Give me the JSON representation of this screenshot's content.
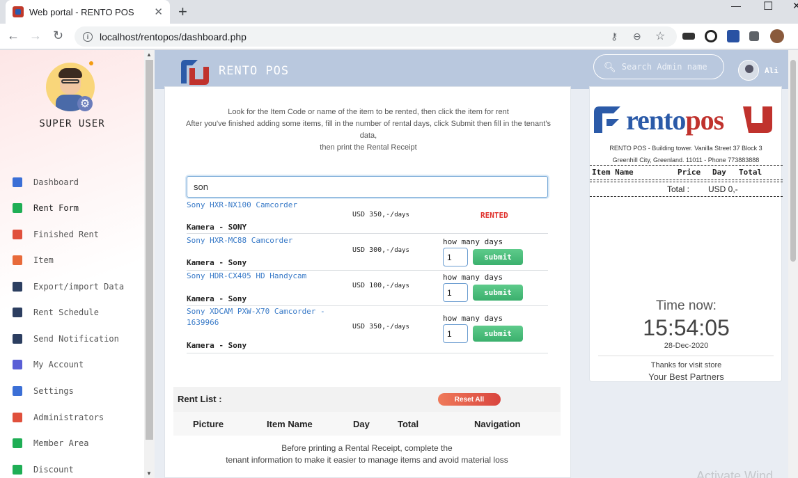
{
  "browser": {
    "tab_title": "Web portal - RENTO POS",
    "url": "localhost/rentopos/dashboard.php"
  },
  "sidebar": {
    "role": "SUPER USER",
    "items": [
      {
        "label": "Dashboard",
        "icon": "monitor-icon",
        "color": "#3b6fd6"
      },
      {
        "label": "Rent Form",
        "icon": "folder-icon",
        "color": "#1fae55"
      },
      {
        "label": "Finished Rent",
        "icon": "folder-icon",
        "color": "#e0503c"
      },
      {
        "label": "Item",
        "icon": "box-icon",
        "color": "#e86a3a"
      },
      {
        "label": "Export/import Data",
        "icon": "list-icon",
        "color": "#2c3e60"
      },
      {
        "label": "Rent Schedule",
        "icon": "calendar-icon",
        "color": "#2c3e60"
      },
      {
        "label": "Send Notification",
        "icon": "paper-plane-icon",
        "color": "#2c3e60"
      },
      {
        "label": "My Account",
        "icon": "user-circle-icon",
        "color": "#5a5fd6"
      },
      {
        "label": "Settings",
        "icon": "gear-icon",
        "color": "#3b6fd6"
      },
      {
        "label": "Administrators",
        "icon": "user-icon",
        "color": "#e0503c"
      },
      {
        "label": "Member Area",
        "icon": "user-icon",
        "color": "#1fae55"
      },
      {
        "label": "Discount",
        "icon": "scissors-icon",
        "color": "#1fae55"
      }
    ]
  },
  "header": {
    "brand": "RENTO POS",
    "search_placeholder": "Search Admin name",
    "user_name": "Ali"
  },
  "rent_form": {
    "instructions": [
      "Look for the Item Code or name of the item to be rented, then click the item for rent",
      "After you've finished adding some items, fill in the number of rental days, click Submit then fill in the tenant's data,",
      "then print the Rental Receipt"
    ],
    "search_value": "son",
    "days_label": "how many days",
    "submit_label": "submit",
    "results": [
      {
        "name": "Sony HXR-NX100 Camcorder",
        "category": "Kamera - SONY",
        "price": "USD 350,-/",
        "unit": "days",
        "status": "RENTED"
      },
      {
        "name": "Sony HXR-MC88 Camcorder",
        "category": "Kamera - Sony",
        "price": "USD 300,-/",
        "unit": "days",
        "days": "1"
      },
      {
        "name": "Sony HDR-CX405 HD Handycam",
        "category": "Kamera - Sony",
        "price": "USD 100,-/",
        "unit": "days",
        "days": "1"
      },
      {
        "name": "Sony XDCAM PXW-X70 Camcorder - 1639966",
        "category": "Kamera - Sony",
        "price": "USD 350,-/",
        "unit": "days",
        "days": "1"
      }
    ]
  },
  "rent_list": {
    "title": "Rent List :",
    "reset_label": "Reset All",
    "columns": [
      "Picture",
      "Item Name",
      "Day",
      "Total",
      "Navigation"
    ],
    "note": [
      "Before printing a Rental Receipt, complete the",
      "tenant information to make it easier to manage items and avoid material loss"
    ]
  },
  "receipt": {
    "logo_text_blue": "rento",
    "logo_text_red": "pos",
    "address_line1": "RENTO POS - Building tower. Vanilla Street 37 Block 3",
    "address_line2": "Greenhill City, Greenland. 11011 - Phone 773883888",
    "columns": [
      "Item Name",
      "Price",
      "Day",
      "Total"
    ],
    "total_label": "Total :",
    "total_value": "USD 0,-",
    "time_label": "Time now:",
    "time": "15:54:05",
    "date": "28-Dec-2020",
    "thanks": "Thanks for visit store",
    "slogan": "Your Best Partners"
  },
  "watermark": "Activate Wind"
}
